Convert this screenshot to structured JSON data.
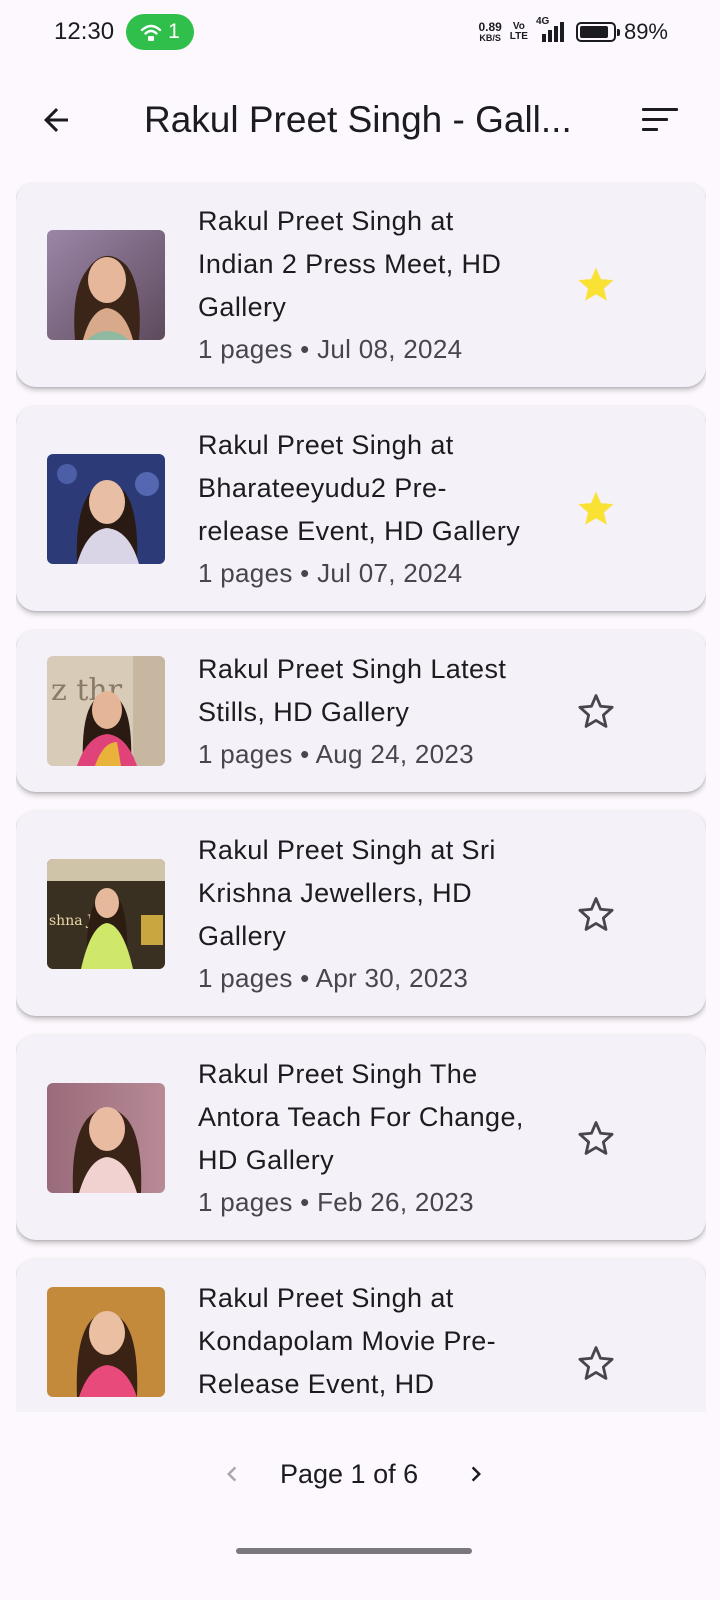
{
  "status_bar": {
    "time": "12:30",
    "hotspot_count": "1",
    "net_speed_value": "0.89",
    "net_speed_unit": "KB/S",
    "volte_top": "Vo",
    "volte_bottom": "LTE",
    "network": "4G",
    "battery": "89%",
    "battery_level": 0.89
  },
  "app_bar": {
    "title": "Rakul Preet Singh - Gall..."
  },
  "galleries": [
    {
      "title": "Rakul Preet Singh at Indian 2 Press Meet, HD Gallery",
      "meta": "1 pages • Jul 08, 2024",
      "favorite": true
    },
    {
      "title": "Rakul Preet Singh at Bharateeyudu2 Pre-release Event, HD Gallery",
      "meta": "1 pages • Jul 07, 2024",
      "favorite": true
    },
    {
      "title": "Rakul Preet Singh Latest Stills, HD Gallery",
      "meta": "1 pages • Aug 24, 2023",
      "favorite": false
    },
    {
      "title": "Rakul Preet Singh at Sri Krishna Jewellers, HD Gallery",
      "meta": "1 pages • Apr 30, 2023",
      "favorite": false
    },
    {
      "title": "Rakul Preet Singh The Antora Teach For Change, HD Gallery",
      "meta": "1 pages • Feb 26, 2023",
      "favorite": false
    },
    {
      "title": "Rakul Preet Singh at Kondapolam Movie Pre-Release Event, HD",
      "meta": "",
      "favorite": false
    }
  ],
  "pagination": {
    "label": "Page 1 of 6"
  },
  "colors": {
    "star_filled": "#f9e234",
    "hotspot_pill": "#2fbf4a",
    "card_bg": "#f5f1f8"
  }
}
